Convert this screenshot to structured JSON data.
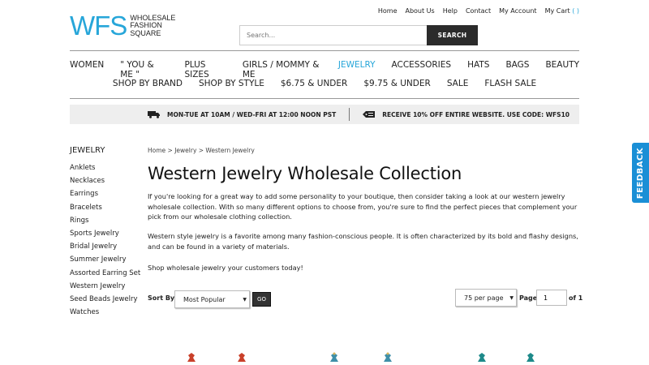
{
  "logo": {
    "mark": "WFS",
    "line1": "WHOLESALE",
    "line2": "FASHION",
    "line3": "SQUARE"
  },
  "top_links": [
    "Home",
    "About Us",
    "Help",
    "Contact",
    "My Account",
    "My Cart"
  ],
  "cart_paren": "( )",
  "search": {
    "placeholder": "Search...",
    "button": "SEARCH"
  },
  "nav": {
    "row1": [
      "WOMEN",
      "\" YOU & ME \"",
      "PLUS SIZES",
      "GIRLS / MOMMY & ME",
      "JEWELRY",
      "ACCESSORIES",
      "HATS",
      "BAGS",
      "BEAUTY"
    ],
    "row2": [
      "SHOP BY BRAND",
      "SHOP BY STYLE",
      "$6.75 & UNDER",
      "$9.75 & UNDER",
      "SALE",
      "FLASH SALE"
    ],
    "active": "JEWELRY"
  },
  "promo": {
    "shipping": "MON-TUE AT 10AM / WED-FRI AT 12:00 NOON PST",
    "discount": "RECEIVE 10% OFF ENTIRE WEBSITE. USE CODE: WFS10"
  },
  "sidebar": {
    "title": "JEWELRY",
    "items": [
      "Anklets",
      "Necklaces",
      "Earrings",
      "Bracelets",
      "Rings",
      "Sports Jewelry",
      "Bridal Jewelry",
      "Summer Jewelry",
      "Assorted Earring Set",
      "Western Jewelry",
      "Seed Beads Jewelry",
      "Watches"
    ]
  },
  "breadcrumb": "Home > Jewelry > Western Jewelry",
  "page_title": "Western Jewelry Wholesale Collection",
  "paragraphs": [
    "If you're looking for a great way to add some personality to your boutique, then consider taking a look at our western jewelry wholesale collection. With so many different options to choose from, you're sure to find the perfect pieces that complement your pick from our wholesale clothing collection.",
    "Western style jewelry is a favorite among many fashion-conscious people. It is often characterized by its bold and flashy designs, and can be found in a variety of materials.",
    "Shop wholesale jewelry your customers today!"
  ],
  "toolbar": {
    "sort_label": "Sort By:",
    "sort_value": "Most Popular",
    "go": "GO",
    "per_page": "75 per page",
    "page_label": "Page",
    "page_value": "1",
    "of_label": "of 1"
  },
  "feedback": "FEEDBACK",
  "colors": {
    "accent": "#27a6d9",
    "feedback": "#1a8fd6",
    "dark_button": "#2b2b2b"
  }
}
